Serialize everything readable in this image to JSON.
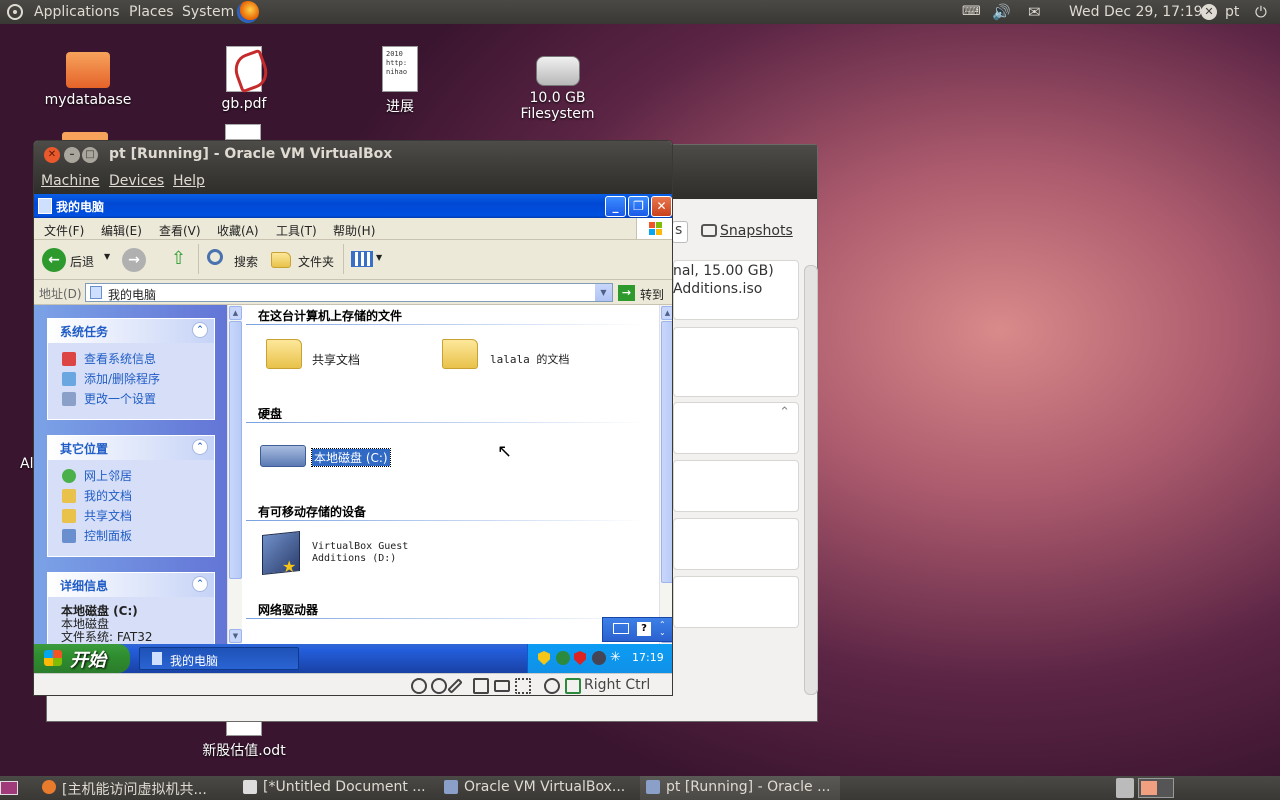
{
  "top_panel": {
    "menus": [
      "Applications",
      "Places",
      "System"
    ],
    "clock": "Wed Dec 29, 17:19",
    "user": "pt"
  },
  "desktop": {
    "icons": [
      {
        "label": "mydatabase",
        "icon": "folder-icon"
      },
      {
        "label": "gb.pdf",
        "icon": "pdf-icon"
      },
      {
        "label": "进展",
        "icon": "text-document-icon",
        "preview": "进展\n2010\nhttp:\nnihao"
      },
      {
        "label": "10.0 GB Filesystem",
        "icon": "harddisk-icon"
      },
      {
        "label": "新股估值.odt",
        "icon": "odt-document-icon"
      }
    ],
    "partial_label": "Al"
  },
  "vbox_manager": {
    "snapshots_tab": "Snapshots",
    "partial_tab": "s",
    "detail_line1": "nal, 15.00 GB)",
    "detail_line2": "Additions.iso"
  },
  "vm_window": {
    "title": "pt [Running] - Oracle VM VirtualBox",
    "menu": [
      "Machine",
      "Devices",
      "Help"
    ],
    "host_key": "Right Ctrl"
  },
  "xp": {
    "window_title": "我的电脑",
    "menu": [
      "文件(F)",
      "编辑(E)",
      "查看(V)",
      "收藏(A)",
      "工具(T)",
      "帮助(H)"
    ],
    "toolbar": {
      "back": "后退",
      "search": "搜索",
      "folders": "文件夹"
    },
    "address_label": "地址(D)",
    "address_value": "我的电脑",
    "go_label": "转到",
    "panels": [
      {
        "title": "系统任务",
        "links": [
          "查看系统信息",
          "添加/删除程序",
          "更改一个设置"
        ]
      },
      {
        "title": "其它位置",
        "links": [
          "网上邻居",
          "我的文档",
          "共享文档",
          "控制面板"
        ]
      },
      {
        "title": "详细信息",
        "name": "本地磁盘 (C:)",
        "type": "本地磁盘",
        "fs": "文件系统: FAT32"
      }
    ],
    "groups": {
      "stored_files": "在这台计算机上存储的文件",
      "hard_disks": "硬盘",
      "removable": "有可移动存储的设备",
      "network": "网络驱动器"
    },
    "items": {
      "shared_docs": "共享文档",
      "user_docs": "lalala 的文档",
      "local_disk": "本地磁盘 (C:)",
      "cd_line1": "VirtualBox Guest",
      "cd_line2": "Additions (D:)"
    },
    "start_label": "开始",
    "taskbar_item": "我的电脑",
    "tray_time": "17:19"
  },
  "bottom_panel": {
    "tasks": [
      "[主机能访问虚拟机共...",
      "[*Untitled Document ...",
      "Oracle VM VirtualBox...",
      "pt [Running] - Oracle ..."
    ]
  },
  "colors": {
    "ubuntu_panel": "#3c3b37",
    "xp_blue": "#0054e3",
    "xp_start_green": "#3c9b3c",
    "xp_link": "#215dc6"
  }
}
